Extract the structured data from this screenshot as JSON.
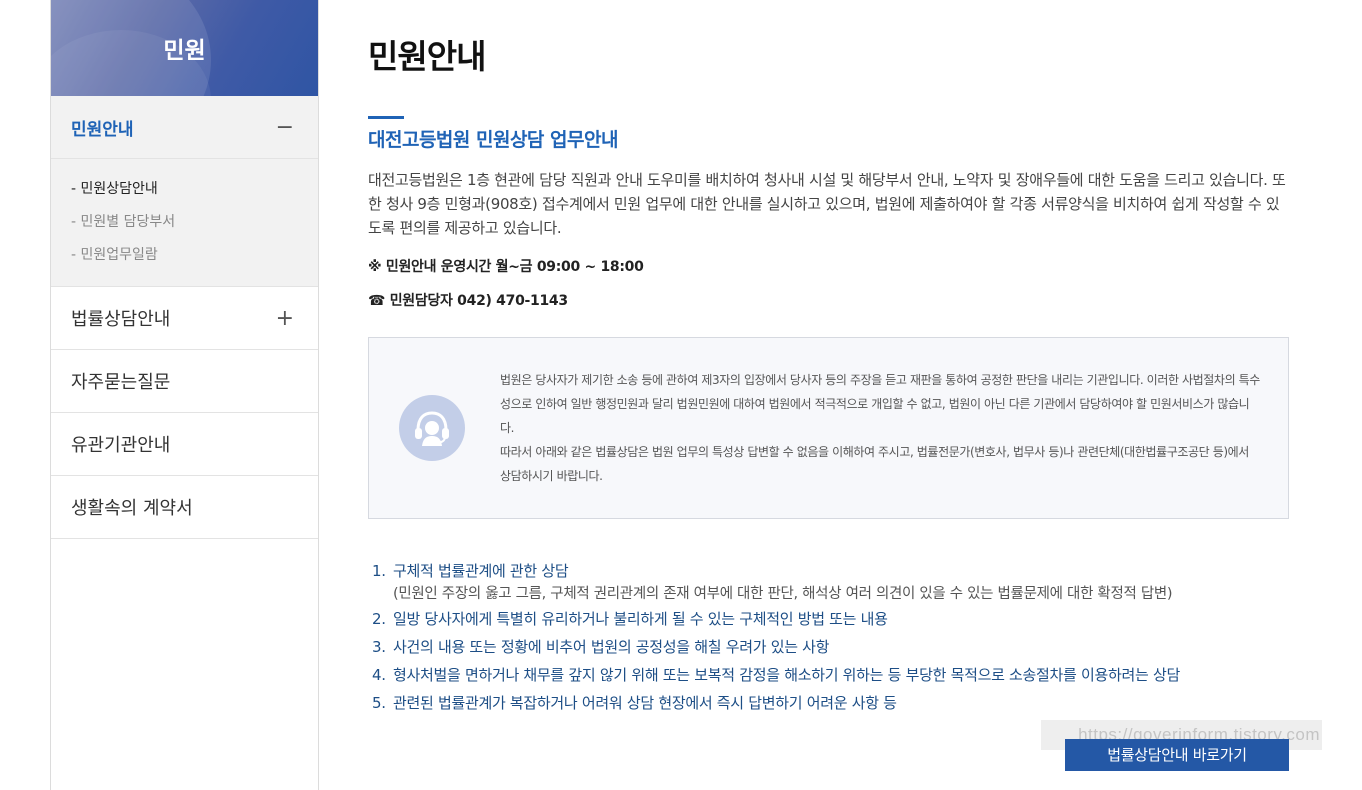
{
  "sidebar": {
    "title": "민원",
    "menu": [
      {
        "label": "민원안내",
        "toggle": "−"
      },
      {
        "label": "법률상담안내",
        "toggle": "+"
      },
      {
        "label": "자주묻는질문"
      },
      {
        "label": "유관기관안내"
      },
      {
        "label": "생활속의 계약서"
      }
    ],
    "submenu": [
      {
        "label": "- 민원상담안내"
      },
      {
        "label": "- 민원별 담당부서"
      },
      {
        "label": "- 민원업무일람"
      }
    ]
  },
  "main": {
    "page_title": "민원안내",
    "section_title": "대전고등법원 민원상담 업무안내",
    "intro": "대전고등법원은 1층 현관에 담당 직원과 안내 도우미를 배치하여 청사내 시설 및 해당부서 안내, 노약자 및 장애우들에 대한 도움을 드리고 있습니다. 또한 청사 9층 민형과(908호) 접수계에서 민원 업무에 대한 안내를 실시하고 있으며, 법원에 제출하여야 할 각종 서류양식을 비치하여 쉽게 작성할 수 있도록 편의를 제공하고 있습니다.",
    "hours": "※ 민원안내 운영시간 월~금 09:00 ~ 18:00",
    "contact": "☎ 민원담당자 042) 470-1143",
    "notice": {
      "icon": "headset-icon",
      "paragraph1": "법원은 당사자가 제기한 소송 등에 관하여 제3자의 입장에서 당사자 등의 주장을 듣고 재판을 통하여 공정한 판단을 내리는 기관입니다. 이러한 사법절차의 특수성으로 인하여 일반 행정민원과 달리 법원민원에 대하여 법원에서 적극적으로 개입할 수 없고, 법원이 아닌 다른 기관에서 담당하여야 할 민원서비스가 많습니다.",
      "paragraph2": "따라서 아래와 같은 법률상담은 법원 업무의 특성상 답변할 수 없음을 이해하여 주시고, 법률전문가(변호사, 법무사 등)나 관련단체(대한법률구조공단 등)에서 상담하시기 바랍니다."
    },
    "rules": [
      {
        "num": "1.",
        "text": "구체적 법률관계에 관한 상담",
        "sub": "(민원인 주장의 옳고 그름, 구체적 권리관계의 존재 여부에 대한 판단, 해석상 여러 의견이 있을 수 있는 법률문제에 대한 확정적 답변)"
      },
      {
        "num": "2.",
        "text": "일방 당사자에게 특별히 유리하거나 불리하게 될 수 있는 구체적인 방법 또는 내용"
      },
      {
        "num": "3.",
        "text": "사건의 내용 또는 정황에 비추어 법원의 공정성을 해칠 우려가 있는 사항"
      },
      {
        "num": "4.",
        "text": "형사처벌을 면하거나 채무를 갚지 않기 위해 또는 보복적 감정을 해소하기 위하는 등 부당한 목적으로 소송절차를 이용하려는 상담"
      },
      {
        "num": "5.",
        "text": "관련된 법률관계가 복잡하거나 어려워 상담 현장에서 즉시 답변하기 어려운 사항 등"
      }
    ],
    "cta_label": "법률상담안내 바로가기",
    "watermark": "https://goverinform.tistory.com"
  },
  "colors": {
    "accent": "#1f63b6",
    "button": "#2458a6",
    "rule_text": "#1d4e86"
  }
}
